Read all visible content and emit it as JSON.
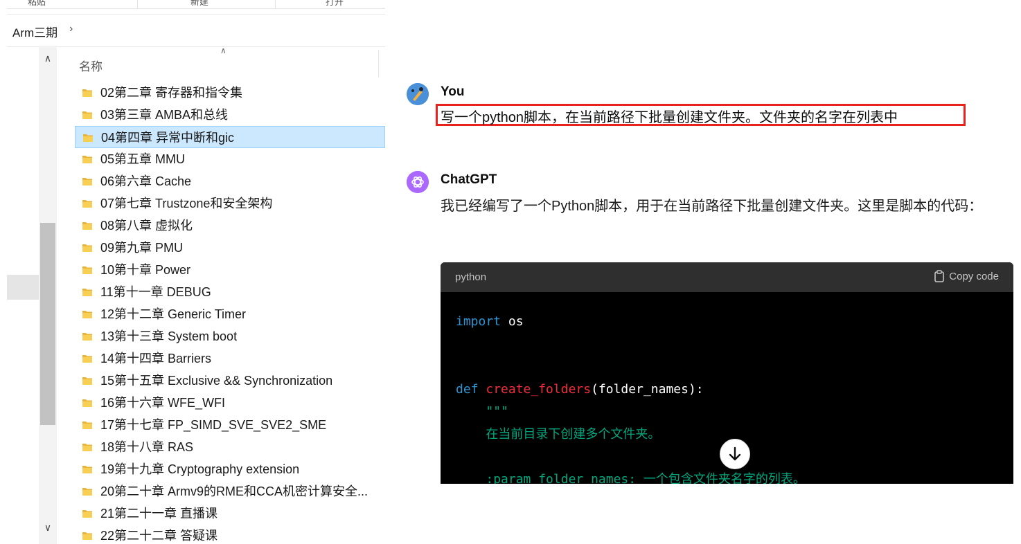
{
  "explorer": {
    "ribbon": [
      "粘贴",
      "新建",
      "打开"
    ],
    "breadcrumb": "Arm三期",
    "column_header": "名称",
    "colors": {
      "selected_bg": "#cce8ff",
      "folder": "#f4c542"
    },
    "files": [
      "02第二章 寄存器和指令集",
      "03第三章 AMBA和总线",
      "04第四章 异常中断和gic",
      "05第五章 MMU",
      "06第六章 Cache",
      "07第七章 Trustzone和安全架构",
      "08第八章 虚拟化",
      "09第九章 PMU",
      "10第十章 Power",
      "11第十一章 DEBUG",
      "12第十二章 Generic Timer",
      "13第十三章 System boot",
      "14第十四章 Barriers",
      "15第十五章 Exclusive && Synchronization",
      "16第十六章 WFE_WFI",
      "17第十七章 FP_SIMD_SVE_SVE2_SME",
      "18第十八章 RAS",
      "19第十九章 Cryptography extension",
      "20第二十章 Armv9的RME和CCA机密计算安全...",
      "21第二十一章 直播课",
      "22第二十二章 答疑课"
    ],
    "selected_index": 2
  },
  "chat": {
    "user": {
      "name": "You",
      "message": "写一个python脚本，在当前路径下批量创建文件夹。文件夹的名字在列表中"
    },
    "assistant": {
      "name": "ChatGPT",
      "message": "我已经编写了一个Python脚本，用于在当前路径下批量创建文件夹。这里是脚本的代码：",
      "code_language": "python",
      "copy_label": "Copy code"
    },
    "colors": {
      "highlight_border": "#e8231e",
      "gpt_avatar": "#ab68ff",
      "code_bg": "#000000"
    }
  }
}
